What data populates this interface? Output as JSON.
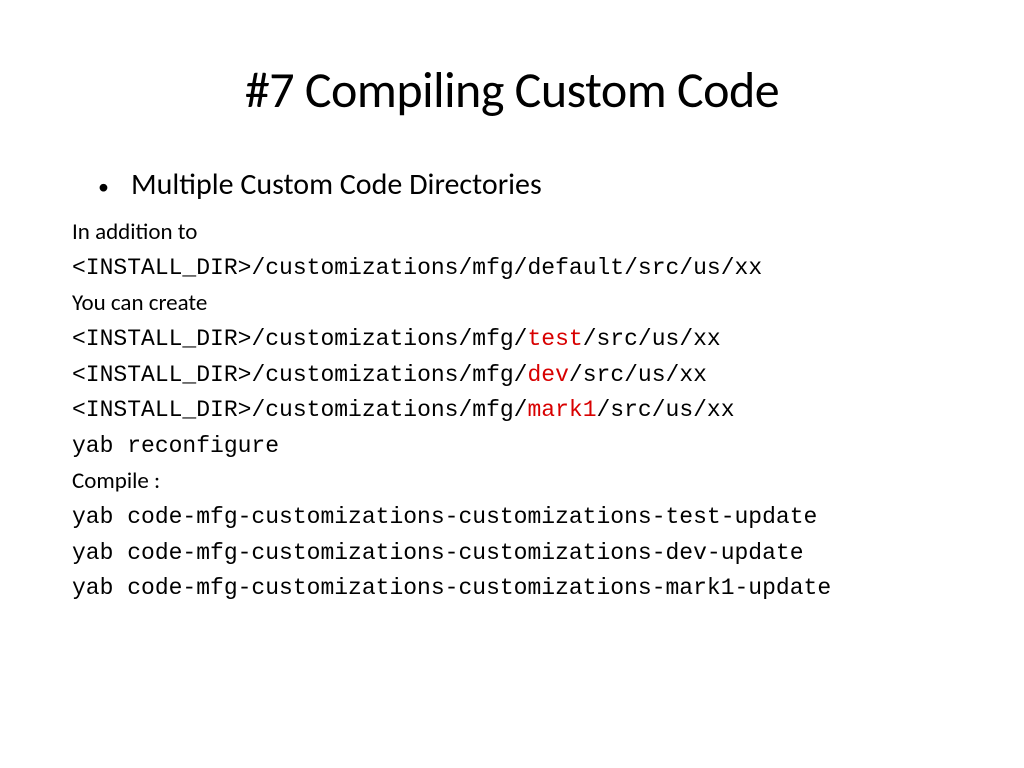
{
  "title": "#7 Compiling Custom Code",
  "bullet": "Multiple Custom Code Directories",
  "in_addition": "In addition to",
  "path_default_pre": "<INSTALL_DIR>",
  "path_default_post": "/customizations/mfg/default/src/us/xx",
  "you_can_create": "You can create",
  "path_pre": "<INSTALL_DIR>",
  "path_mid": "/customizations/mfg/",
  "path_post": "/src/us/xx",
  "env_test": "test",
  "env_dev": "dev",
  "env_mark1": "mark1",
  "yab_reconfigure": "yab reconfigure",
  "compile_label": "Compile :",
  "cmd_test": "yab code-mfg-customizations-customizations-test-update",
  "cmd_dev": "yab code-mfg-customizations-customizations-dev-update",
  "cmd_mark1": "yab code-mfg-customizations-customizations-mark1-update"
}
